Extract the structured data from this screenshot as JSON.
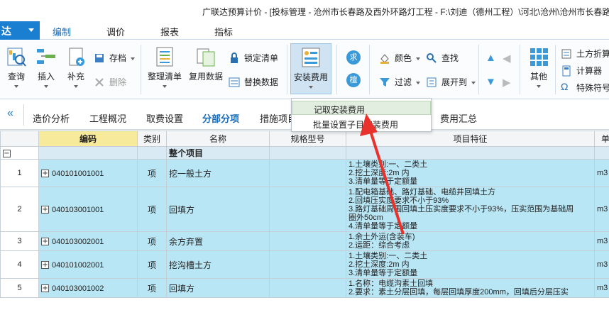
{
  "window": {
    "title": "广联达预算计价 - [投标管理 - 沧州市长春路及西外环路灯工程 - F:\\刘迪（德州工程）\\河北\\沧州\\沧州市长春路及西"
  },
  "app_button": {
    "label": "达"
  },
  "menu_tabs": [
    {
      "label": "编制"
    },
    {
      "label": "调价"
    },
    {
      "label": "报表"
    },
    {
      "label": "指标"
    }
  ],
  "ribbon": {
    "query": "查询",
    "insert": "插入",
    "supplement": "补充",
    "save": "存档",
    "delete": "删除",
    "organize": "整理清单",
    "reuse": "复用数据",
    "lock": "锁定清单",
    "replace": "替换数据",
    "install_fee": "安装费用",
    "ask": "求",
    "ask2": "檀",
    "color": "颜色",
    "find": "查找",
    "filter": "过滤",
    "expand_to": "展开到",
    "other": "其他",
    "earthwork": "土方折算",
    "calculator": "计算器",
    "special_symbol": "特殊符号"
  },
  "dropdown": [
    {
      "label": "记取安装费用"
    },
    {
      "label": "批量设置子目安装费用"
    }
  ],
  "func_tabs": [
    {
      "label": "造价分析"
    },
    {
      "label": "工程概况"
    },
    {
      "label": "取费设置"
    },
    {
      "label": "分部分项"
    },
    {
      "label": "措施项目"
    },
    {
      "label": "费用汇总"
    }
  ],
  "table": {
    "headers": {
      "code": "编码",
      "type": "类别",
      "name": "名称",
      "spec": "规格型号",
      "feature": "项目特征",
      "unit": "单位"
    },
    "group_label": "整个项目",
    "rows": [
      {
        "num": "1",
        "code": "040101001001",
        "type": "项",
        "name": "挖一般土方",
        "features": [
          "1.土壤类别:一、二类土",
          "2.挖土深度:2m 内",
          "3.清单量等于定额量"
        ],
        "unit": "m3"
      },
      {
        "num": "2",
        "code": "040103001001",
        "type": "项",
        "name": "回填方",
        "features": [
          "1.配电箱基础、路灯基础、电缆井回填土方",
          "2.回填压实度要求不小于93%",
          "3.路灯基础周围回填土压实度要求不小于93%，压实范围为基础周",
          "圈外50cm",
          "4.清单量等于定额量"
        ],
        "unit": "m3"
      },
      {
        "num": "3",
        "code": "040103002001",
        "type": "项",
        "name": "余方弃置",
        "features": [
          "1.余土外运(含装车)",
          "2.运距：综合考虑"
        ],
        "unit": "m3"
      },
      {
        "num": "4",
        "code": "040101002001",
        "type": "项",
        "name": "挖沟槽土方",
        "features": [
          "1.土壤类别:一、二类土",
          "2.挖土深度:2m 内",
          "3.清单量等于定额量"
        ],
        "unit": "m3"
      },
      {
        "num": "5",
        "code": "040103001002",
        "type": "项",
        "name": "回填方",
        "features": [
          "1.名称：电缆沟素土回填",
          "2.要求：素土分层回填，每层回填厚度200mm，回填后分层压实"
        ],
        "unit": "m3"
      }
    ]
  },
  "colors": {
    "accent": "#1a7fd1",
    "row_bg": "#b9e6f5",
    "header_hl": "#f7ea9a",
    "arrow": "#e8322b"
  }
}
